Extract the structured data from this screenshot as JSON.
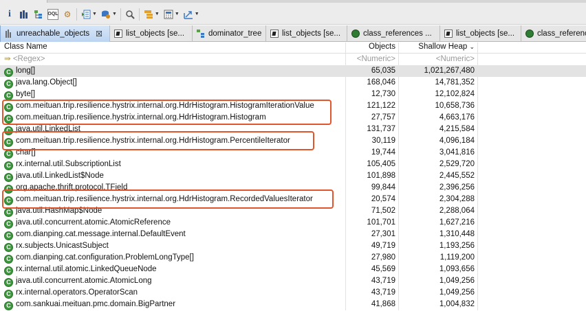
{
  "toolbar": {
    "icons": [
      "info-icon",
      "histogram-icon",
      "dominator-tree-icon",
      "oql-icon",
      "heap-dump-overview-icon",
      "reports-icon",
      "query-browser-icon",
      "search-icon",
      "group-by-icon",
      "calculator-icon",
      "export-icon"
    ]
  },
  "tabs": [
    {
      "label": "unreachable_objects",
      "icon": "histogram-icon",
      "active": true,
      "closable": true
    },
    {
      "label": "list_objects  [se...",
      "icon": "document-icon"
    },
    {
      "label": "dominator_tree",
      "icon": "dominator-tree-icon"
    },
    {
      "label": "list_objects  [se...",
      "icon": "document-icon"
    },
    {
      "label": "class_references ...",
      "icon": "class-references-icon"
    },
    {
      "label": "list_objects  [se...",
      "icon": "document-icon"
    },
    {
      "label": "class_references",
      "icon": "class-references-icon"
    }
  ],
  "table": {
    "columns": [
      "Class Name",
      "Objects",
      "Shallow Heap"
    ],
    "sort_indicator": "⌄",
    "filter": {
      "name": "<Regex>",
      "objects": "<Numeric>",
      "shallow": "<Numeric>"
    },
    "rows": [
      {
        "name": "long[]",
        "objects": "65,035",
        "shallow": "1,021,267,480",
        "selected": true
      },
      {
        "name": "java.lang.Object[]",
        "objects": "168,046",
        "shallow": "14,781,352"
      },
      {
        "name": "byte[]",
        "objects": "12,730",
        "shallow": "12,102,824"
      },
      {
        "name": "com.meituan.trip.resilience.hystrix.internal.org.HdrHistogram.HistogramIterationValue",
        "objects": "121,122",
        "shallow": "10,658,736"
      },
      {
        "name": "com.meituan.trip.resilience.hystrix.internal.org.HdrHistogram.Histogram",
        "objects": "27,757",
        "shallow": "4,663,176"
      },
      {
        "name": "java.util.LinkedList",
        "objects": "131,737",
        "shallow": "4,215,584"
      },
      {
        "name": "com.meituan.trip.resilience.hystrix.internal.org.HdrHistogram.PercentileIterator",
        "objects": "30,119",
        "shallow": "4,096,184"
      },
      {
        "name": "char[]",
        "objects": "19,744",
        "shallow": "3,041,816"
      },
      {
        "name": "rx.internal.util.SubscriptionList",
        "objects": "105,405",
        "shallow": "2,529,720"
      },
      {
        "name": "java.util.LinkedList$Node",
        "objects": "101,898",
        "shallow": "2,445,552"
      },
      {
        "name": "org.apache.thrift.protocol.TField",
        "objects": "99,844",
        "shallow": "2,396,256"
      },
      {
        "name": "com.meituan.trip.resilience.hystrix.internal.org.HdrHistogram.RecordedValuesIterator",
        "objects": "20,574",
        "shallow": "2,304,288"
      },
      {
        "name": "java.util.HashMap$Node",
        "objects": "71,502",
        "shallow": "2,288,064"
      },
      {
        "name": "java.util.concurrent.atomic.AtomicReference",
        "objects": "101,701",
        "shallow": "1,627,216"
      },
      {
        "name": "com.dianping.cat.message.internal.DefaultEvent",
        "objects": "27,301",
        "shallow": "1,310,448"
      },
      {
        "name": "rx.subjects.UnicastSubject",
        "objects": "49,719",
        "shallow": "1,193,256"
      },
      {
        "name": "com.dianping.cat.configuration.ProblemLongType[]",
        "objects": "27,980",
        "shallow": "1,119,200"
      },
      {
        "name": "rx.internal.util.atomic.LinkedQueueNode",
        "objects": "45,569",
        "shallow": "1,093,656"
      },
      {
        "name": "java.util.concurrent.atomic.AtomicLong",
        "objects": "43,719",
        "shallow": "1,049,256"
      },
      {
        "name": "rx.internal.operators.OperatorScan",
        "objects": "43,719",
        "shallow": "1,049,256"
      },
      {
        "name": "com.sankuai.meituan.pmc.domain.BigPartner",
        "objects": "41,868",
        "shallow": "1,004,832"
      }
    ]
  },
  "highlight_color": "#e0552b"
}
